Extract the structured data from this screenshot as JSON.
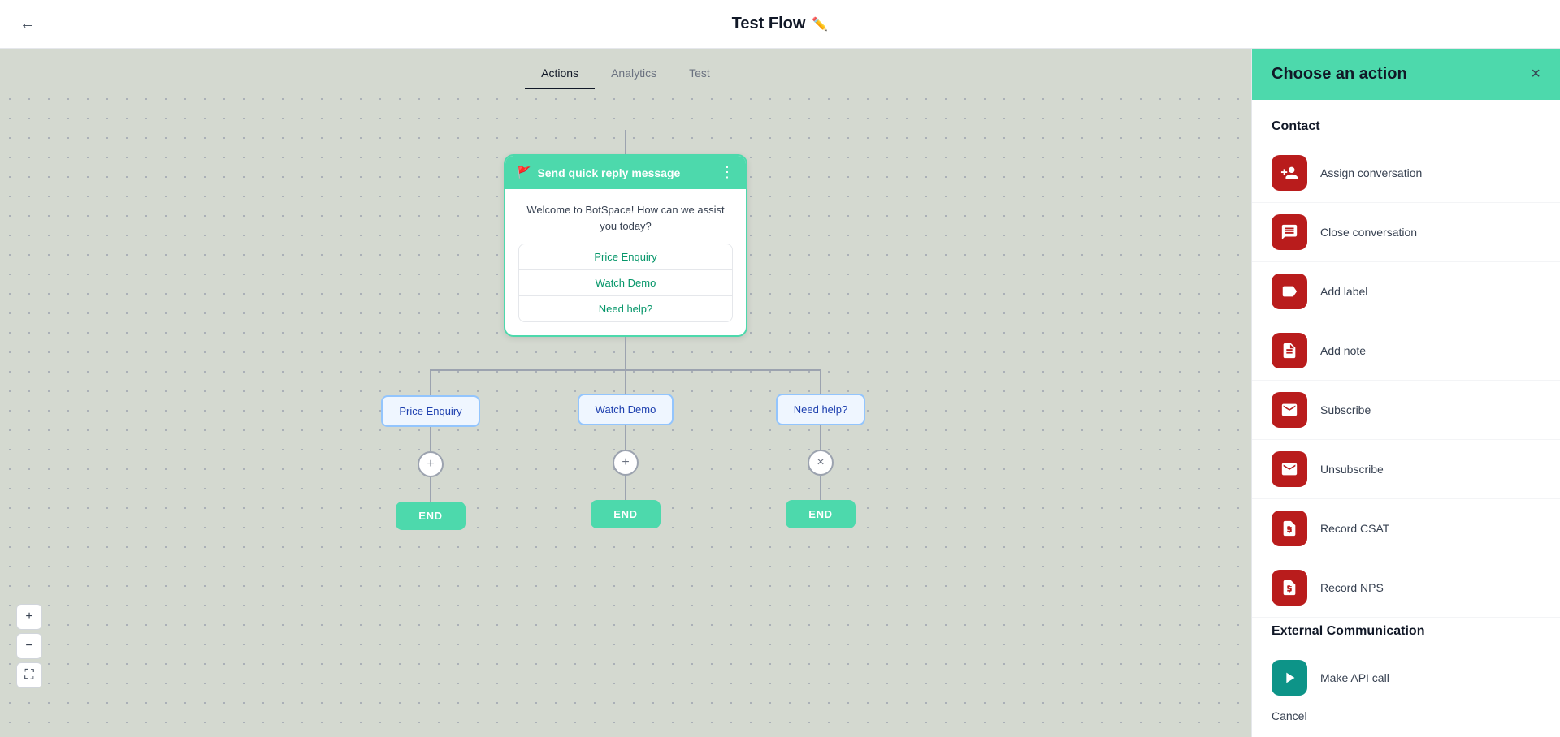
{
  "header": {
    "title": "Test Flow",
    "back_label": "←",
    "edit_icon": "✏️"
  },
  "tabs": [
    {
      "label": "Actions",
      "active": true
    },
    {
      "label": "Analytics",
      "active": false
    },
    {
      "label": "Test",
      "active": false
    }
  ],
  "flow": {
    "main_node": {
      "header_label": "Send quick reply message",
      "message": "Welcome to BotSpace! How can we assist you today?",
      "replies": [
        {
          "label": "Price Enquiry"
        },
        {
          "label": "Watch Demo"
        },
        {
          "label": "Need help?"
        }
      ]
    },
    "branches": [
      {
        "label": "Price Enquiry",
        "circle_symbol": "+",
        "end_label": "END"
      },
      {
        "label": "Watch Demo",
        "circle_symbol": "+",
        "end_label": "END"
      },
      {
        "label": "Need help?",
        "circle_symbol": "×",
        "end_label": "END"
      }
    ]
  },
  "zoom_controls": {
    "plus": "+",
    "minus": "−",
    "fit": "⛶"
  },
  "right_panel": {
    "title": "Choose an action",
    "close_label": "×",
    "sections": [
      {
        "title": "Contact",
        "items": [
          {
            "icon": "👤+",
            "label": "Assign conversation"
          },
          {
            "icon": "💬×",
            "label": "Close conversation"
          },
          {
            "icon": "🏷+",
            "label": "Add label"
          },
          {
            "icon": "📄+",
            "label": "Add note"
          },
          {
            "icon": "✉️",
            "label": "Subscribe"
          },
          {
            "icon": "✉️×",
            "label": "Unsubscribe"
          },
          {
            "icon": "📄★",
            "label": "Record CSAT"
          },
          {
            "icon": "📄#",
            "label": "Record NPS"
          }
        ]
      },
      {
        "title": "External Communication",
        "items": [
          {
            "icon": "🔗",
            "label": "Make API call"
          }
        ]
      }
    ],
    "cancel_label": "Cancel"
  }
}
